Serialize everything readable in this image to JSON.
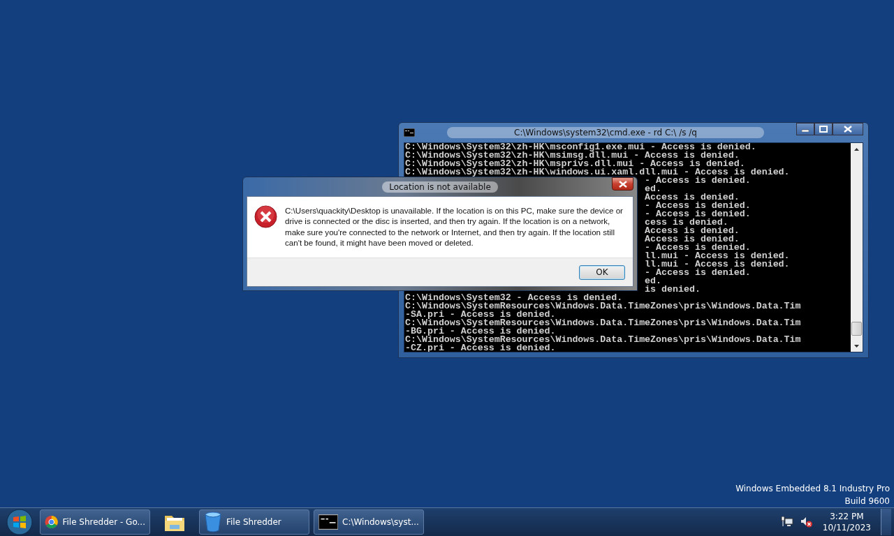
{
  "console_window": {
    "title": "C:\\Windows\\system32\\cmd.exe - rd  C:\\ /s /q",
    "lines": [
      {
        "kind": "full",
        "text": "C:\\Windows\\System32\\zh-HK\\msconfig1.exe.mui - Access is denied."
      },
      {
        "kind": "full",
        "text": "C:\\Windows\\System32\\zh-HK\\msimsg.dll.mui - Access is denied."
      },
      {
        "kind": "full",
        "text": "C:\\Windows\\System32\\zh-HK\\msprivs.dll.mui - Access is denied."
      },
      {
        "kind": "full",
        "text": "C:\\Windows\\System32\\zh-HK\\windows.ui.xaml.dll.mui - Access is denied."
      },
      {
        "kind": "partial",
        "text": "- Access is denied."
      },
      {
        "kind": "partial",
        "text": "ed."
      },
      {
        "kind": "partial",
        "text": "Access is denied."
      },
      {
        "kind": "partial",
        "text": "- Access is denied."
      },
      {
        "kind": "partial",
        "text": "- Access is denied."
      },
      {
        "kind": "partial",
        "text": "cess is denied."
      },
      {
        "kind": "partial",
        "text": "Access is denied."
      },
      {
        "kind": "partial",
        "text": "Access is denied."
      },
      {
        "kind": "partial",
        "text": "- Access is denied."
      },
      {
        "kind": "partial",
        "text": "ll.mui - Access is denied."
      },
      {
        "kind": "partial",
        "text": "ll.mui - Access is denied."
      },
      {
        "kind": "partial",
        "text": "- Access is denied."
      },
      {
        "kind": "partial",
        "text": "ed."
      },
      {
        "kind": "partial",
        "text": "is denied."
      },
      {
        "kind": "full",
        "text": "C:\\Windows\\System32 - Access is denied."
      },
      {
        "kind": "full",
        "text": "C:\\Windows\\SystemResources\\Windows.Data.TimeZones\\pris\\Windows.Data.Tim"
      },
      {
        "kind": "full",
        "text": "-SA.pri - Access is denied."
      },
      {
        "kind": "full",
        "text": "C:\\Windows\\SystemResources\\Windows.Data.TimeZones\\pris\\Windows.Data.Tim"
      },
      {
        "kind": "full",
        "text": "-BG.pri - Access is denied."
      },
      {
        "kind": "full",
        "text": "C:\\Windows\\SystemResources\\Windows.Data.TimeZones\\pris\\Windows.Data.Tim"
      },
      {
        "kind": "full",
        "text": "-CZ.pri - Access is denied."
      }
    ]
  },
  "dialog": {
    "title": "Location is not available",
    "message": "C:\\Users\\quackity\\Desktop is unavailable. If the location is on this PC, make sure the device or drive is connected or the disc is inserted, and then try again. If the location is on a network, make sure you're connected to the network or Internet, and then try again. If the location still can't be found, it might have been moved or deleted.",
    "button": "OK"
  },
  "desktop": {
    "edition_lines": [
      "Windows Embedded 8.1 Industry Pro",
      "Build 9600"
    ]
  },
  "taskbar": {
    "items": [
      {
        "kind": "browser",
        "label": "File Shredder - Go..."
      },
      {
        "kind": "folder"
      },
      {
        "kind": "bin",
        "label": "File Shredder"
      },
      {
        "kind": "console",
        "label": "C:\\Windows\\syst..."
      }
    ],
    "clock": {
      "time": "3:22 PM",
      "date": "10/11/2023"
    }
  }
}
